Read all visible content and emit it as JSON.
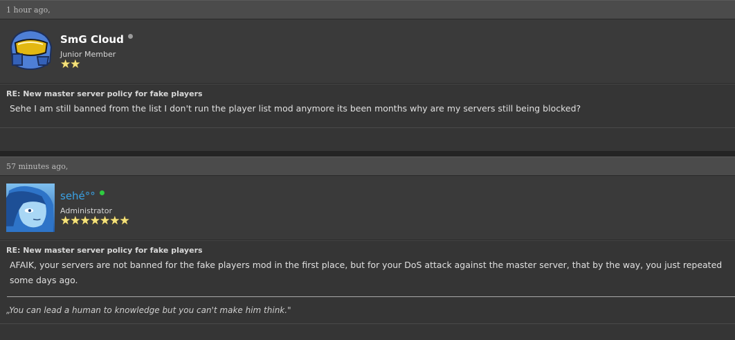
{
  "posts": [
    {
      "time": "1 hour ago,",
      "username": "SmG Cloud",
      "online": false,
      "rank": "Junior Member",
      "stars": "★★",
      "subject": "RE: New master server policy for fake players",
      "body": "Sehe I am still banned from the list I don't run the player list mod anymore its been months why are my servers still being blocked?"
    },
    {
      "time": "57 minutes ago,",
      "username": "sehé°°",
      "online": true,
      "rank": "Administrator",
      "stars": "★★★★★★★",
      "subject": "RE: New master server policy for fake players",
      "body": "AFAIK, your servers are not banned for the fake players mod in the first place, but for your DoS attack against the master server, that by the way, you just repeated some days ago.",
      "signature": "„You can lead a human to knowledge but you can't make him think.\""
    }
  ],
  "colors": {
    "offline_dot": "#9a9a9a",
    "online_dot": "#2ecc40",
    "admin_name": "#3aa3e6",
    "stars": "#f5e27a"
  },
  "icons": {
    "avatar_1": "halo-helmet-avatar",
    "avatar_2": "anime-portrait-avatar"
  }
}
